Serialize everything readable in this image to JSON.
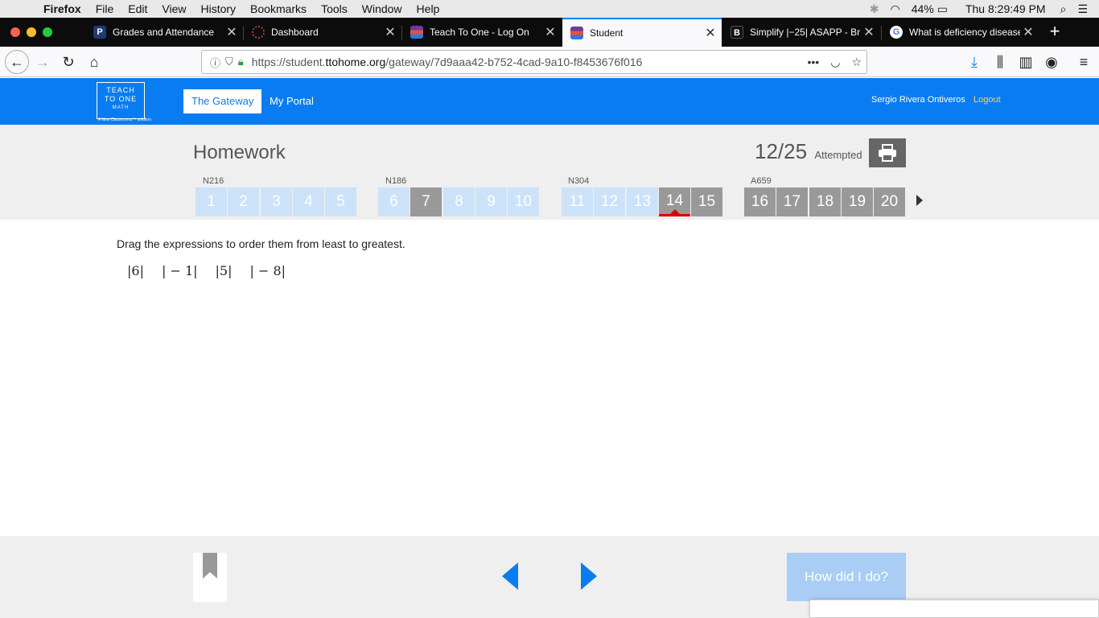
{
  "menubar": {
    "app": "Firefox",
    "items": [
      "File",
      "Edit",
      "View",
      "History",
      "Bookmarks",
      "Tools",
      "Window",
      "Help"
    ],
    "battery": "44%",
    "clock": "Thu 8:29:49 PM"
  },
  "tabs": [
    {
      "title": "Grades and Attendance",
      "color": "#1f3a6e",
      "glyph": "P"
    },
    {
      "title": "Dashboard",
      "color": "#c0392b",
      "glyph": ""
    },
    {
      "title": "Teach To One - Log On",
      "color": "#6a3d9a",
      "glyph": ""
    },
    {
      "title": "Student",
      "color": "#6a3d9a",
      "glyph": ""
    },
    {
      "title": "Simplify |−25| ASAPP - Br",
      "color": "#111111",
      "glyph": "B"
    },
    {
      "title": "What is deficiency disease",
      "color": "#4285f4",
      "glyph": "G"
    }
  ],
  "urlbar": {
    "prefix": "https://student.",
    "domain": "ttohome.org",
    "path": "/gateway/7d9aaa42-b752-4cad-9a10-f8453676f016"
  },
  "site": {
    "logo_line1": "TEACH",
    "logo_line2": "TO ONE",
    "logo_line3": "MATH",
    "logo_tag": "A New Classrooms™ solution",
    "nav_gateway": "The Gateway",
    "nav_portal": "My Portal",
    "user_name": "Sergio Rivera Ontiveros",
    "logout": "Logout"
  },
  "homework": {
    "title": "Homework",
    "score": "12/25",
    "score_label": "Attempted",
    "groups": [
      {
        "label": "N216",
        "questions": [
          {
            "n": "1",
            "state": "light"
          },
          {
            "n": "2",
            "state": "light"
          },
          {
            "n": "3",
            "state": "light"
          },
          {
            "n": "4",
            "state": "light"
          },
          {
            "n": "5",
            "state": "light"
          }
        ]
      },
      {
        "label": "N186",
        "questions": [
          {
            "n": "6",
            "state": "light"
          },
          {
            "n": "7",
            "state": "gray"
          },
          {
            "n": "8",
            "state": "light"
          },
          {
            "n": "9",
            "state": "light"
          },
          {
            "n": "10",
            "state": "light"
          }
        ]
      },
      {
        "label": "N304",
        "questions": [
          {
            "n": "11",
            "state": "light"
          },
          {
            "n": "12",
            "state": "light"
          },
          {
            "n": "13",
            "state": "light"
          },
          {
            "n": "14",
            "state": "current"
          },
          {
            "n": "15",
            "state": "gray"
          }
        ]
      },
      {
        "label": "A659",
        "questions": [
          {
            "n": "16",
            "state": "gray"
          },
          {
            "n": "17",
            "state": "gray"
          },
          {
            "n": "18",
            "state": "gray"
          },
          {
            "n": "19",
            "state": "gray"
          },
          {
            "n": "20",
            "state": "gray"
          }
        ]
      }
    ]
  },
  "question": {
    "instruction": "Drag the expressions to order them from least to greatest.",
    "expressions": [
      "|6|",
      "| − 1|",
      "|5|",
      "| − 8|"
    ]
  },
  "footer": {
    "how_label": "How did I do?"
  },
  "colors": {
    "brand": "#0a7cf2",
    "light_q": "#cce2f9",
    "gray_q": "#999999",
    "current_marker": "#dd0000"
  }
}
